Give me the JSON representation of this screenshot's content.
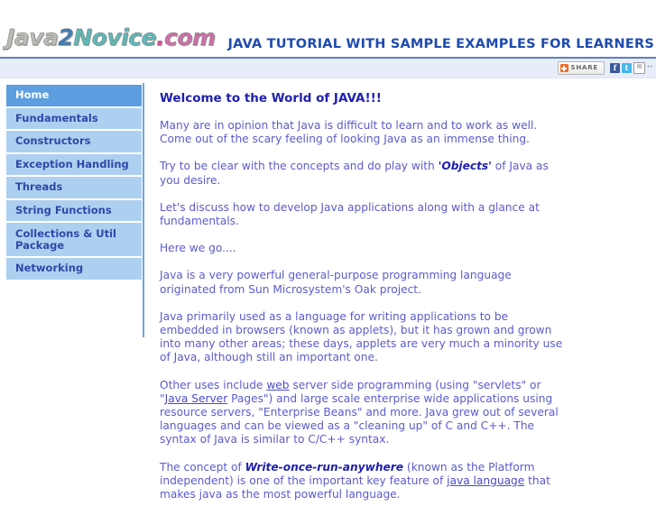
{
  "header": {
    "logo": {
      "part1": "Java",
      "part2": "2",
      "part3": "Novice",
      "part4": ".",
      "part5": "com"
    },
    "title": "JAVA TUTORIAL WITH SAMPLE EXAMPLES FOR LEARNERS"
  },
  "share_bar": {
    "share_label": "SHARE",
    "plus_icon": "plus-icon",
    "icons": [
      {
        "name": "facebook-icon",
        "glyph": "f"
      },
      {
        "name": "twitter-icon",
        "glyph": "t"
      },
      {
        "name": "email-icon",
        "glyph": "✉"
      },
      {
        "name": "more-icon",
        "glyph": "··"
      }
    ]
  },
  "sidebar": {
    "items": [
      {
        "label": "Home",
        "active": true
      },
      {
        "label": "Fundamentals",
        "active": false
      },
      {
        "label": "Constructors",
        "active": false
      },
      {
        "label": "Exception Handling",
        "active": false
      },
      {
        "label": "Threads",
        "active": false
      },
      {
        "label": "String Functions",
        "active": false
      },
      {
        "label": "Collections & Util Package",
        "active": false
      },
      {
        "label": "Networking",
        "active": false
      }
    ]
  },
  "content": {
    "heading": "Welcome to the World of JAVA!!!",
    "p1": "Many are in opinion that Java is difficult to learn and to work as well. Come out of the scary feeling of looking Java as an immense thing.",
    "p2_before": "Try to be clear with the concepts and do play with ",
    "p2_emphasis": "'Objects'",
    "p2_after": " of Java as you desire.",
    "p3": "Let's discuss how to develop Java applications along with a glance at fundamentals.",
    "p4": "Here we go....",
    "p5": "Java is a very powerful general-purpose programming language originated from Sun Microsystem's Oak project.",
    "p6": "Java primarily used as a language for writing applications to be embedded in browsers (known as applets), but it has grown and grown into many other areas; these days, applets are very much a minority use of Java, although still an important one.",
    "p7_a": "Other uses include ",
    "p7_link1": "web",
    "p7_b": " server side programming (using \"servlets\" or \"",
    "p7_link2": "Java Server",
    "p7_c": " Pages\") and large scale enterprise wide applications using resource servers, \"Enterprise Beans\" and more. Java grew out of several languages and can be viewed as a \"cleaning up\" of C and C++. The syntax of Java is similar to C/C++ syntax.",
    "p8_a": "The concept of ",
    "p8_emphasis": "Write-once-run-anywhere",
    "p8_b": " (known as the Platform independent) is one of the important key feature of ",
    "p8_link": "java language",
    "p8_c": " that makes java as the most powerful language."
  },
  "colors": {
    "accent_blue": "#1f4bb0",
    "nav_active": "#5c9ee0",
    "nav_inactive": "#aed0f0",
    "body_text": "#5b5bd0",
    "share_orange": "#f26c22"
  }
}
